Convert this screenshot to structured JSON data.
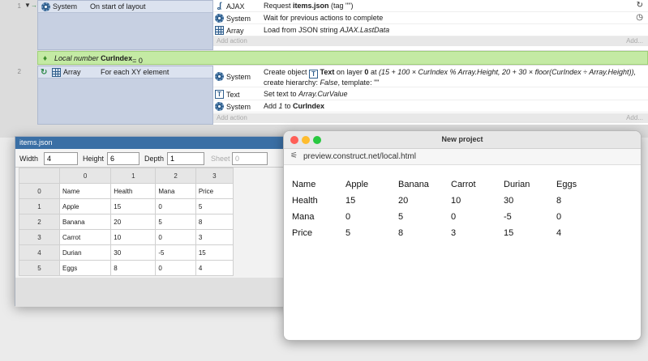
{
  "events": {
    "event1": {
      "line": "1",
      "condition": {
        "object": "System",
        "text": "On start of layout"
      },
      "actions": [
        {
          "object": "AJAX",
          "icon": "ajax-icon",
          "pre": "Request ",
          "bold": "items.json",
          "post": " (tag \"\")"
        },
        {
          "object": "System",
          "icon": "gear-icon",
          "text": "Wait for previous actions to complete"
        },
        {
          "object": "Array",
          "icon": "array-icon",
          "pre": "Load from JSON string ",
          "italic": "AJAX.LastData"
        }
      ],
      "add_action": "Add action",
      "add_more": "Add..."
    },
    "local_var": {
      "italic": "Local number",
      "bold": "CurIndex",
      "post": " = 0"
    },
    "event2": {
      "line": "2",
      "condition": {
        "object": "Array",
        "text": "For each XY element"
      },
      "actions": [
        {
          "object": "System",
          "icon": "gear-icon",
          "line1_a": "Create object ",
          "line1_b": "Text",
          "line1_c": " on layer ",
          "line1_d": "0",
          "line1_e": " at ",
          "line1_f": "(15 + 100 × CurIndex % Array.Height, 20 + 30 × floor(CurIndex ÷ Array.Height)),",
          "line2_a": "create hierarchy: ",
          "line2_b": "False",
          "line2_c": ", template: \"\""
        },
        {
          "object": "Text",
          "icon": "text-icon",
          "pre": "Set text to ",
          "italic": "Array.CurValue"
        },
        {
          "object": "System",
          "icon": "gear-icon",
          "pre": "Add ",
          "italic": "1",
          "mid": " to ",
          "bold": "CurIndex"
        }
      ],
      "add_action": "Add action",
      "add_more": "Add..."
    }
  },
  "json_editor": {
    "title": "items.json",
    "width_label": "Width",
    "width_value": "4",
    "height_label": "Height",
    "height_value": "6",
    "depth_label": "Depth",
    "depth_value": "1",
    "sheet_label": "Sheet",
    "sheet_value": "0",
    "col_headers": [
      "0",
      "1",
      "2",
      "3"
    ],
    "rows": [
      {
        "index": "0",
        "cells": [
          "Name",
          "Health",
          "Mana",
          "Price"
        ]
      },
      {
        "index": "1",
        "cells": [
          "Apple",
          "15",
          "0",
          "5"
        ]
      },
      {
        "index": "2",
        "cells": [
          "Banana",
          "20",
          "5",
          "8"
        ]
      },
      {
        "index": "3",
        "cells": [
          "Carrot",
          "10",
          "0",
          "3"
        ]
      },
      {
        "index": "4",
        "cells": [
          "Durian",
          "30",
          "-5",
          "15"
        ]
      },
      {
        "index": "5",
        "cells": [
          "Eggs",
          "8",
          "0",
          "4"
        ]
      }
    ]
  },
  "preview": {
    "title": "New project",
    "url": "preview.construct.net/local.html",
    "rows": [
      [
        "Name",
        "Apple",
        "Banana",
        "Carrot",
        "Durian",
        "Eggs"
      ],
      [
        "Health",
        "15",
        "20",
        "10",
        "30",
        "8"
      ],
      [
        "Mana",
        "0",
        "5",
        "0",
        "-5",
        "0"
      ],
      [
        "Price",
        "5",
        "8",
        "3",
        "15",
        "4"
      ]
    ]
  },
  "colors": {
    "accent": "#3a6fa5",
    "condition_bg": "#c7d0e2",
    "local_var_bg": "#c4eaa4",
    "tl_close": "#ff5f57",
    "tl_min": "#febc2e",
    "tl_max": "#28c840"
  }
}
